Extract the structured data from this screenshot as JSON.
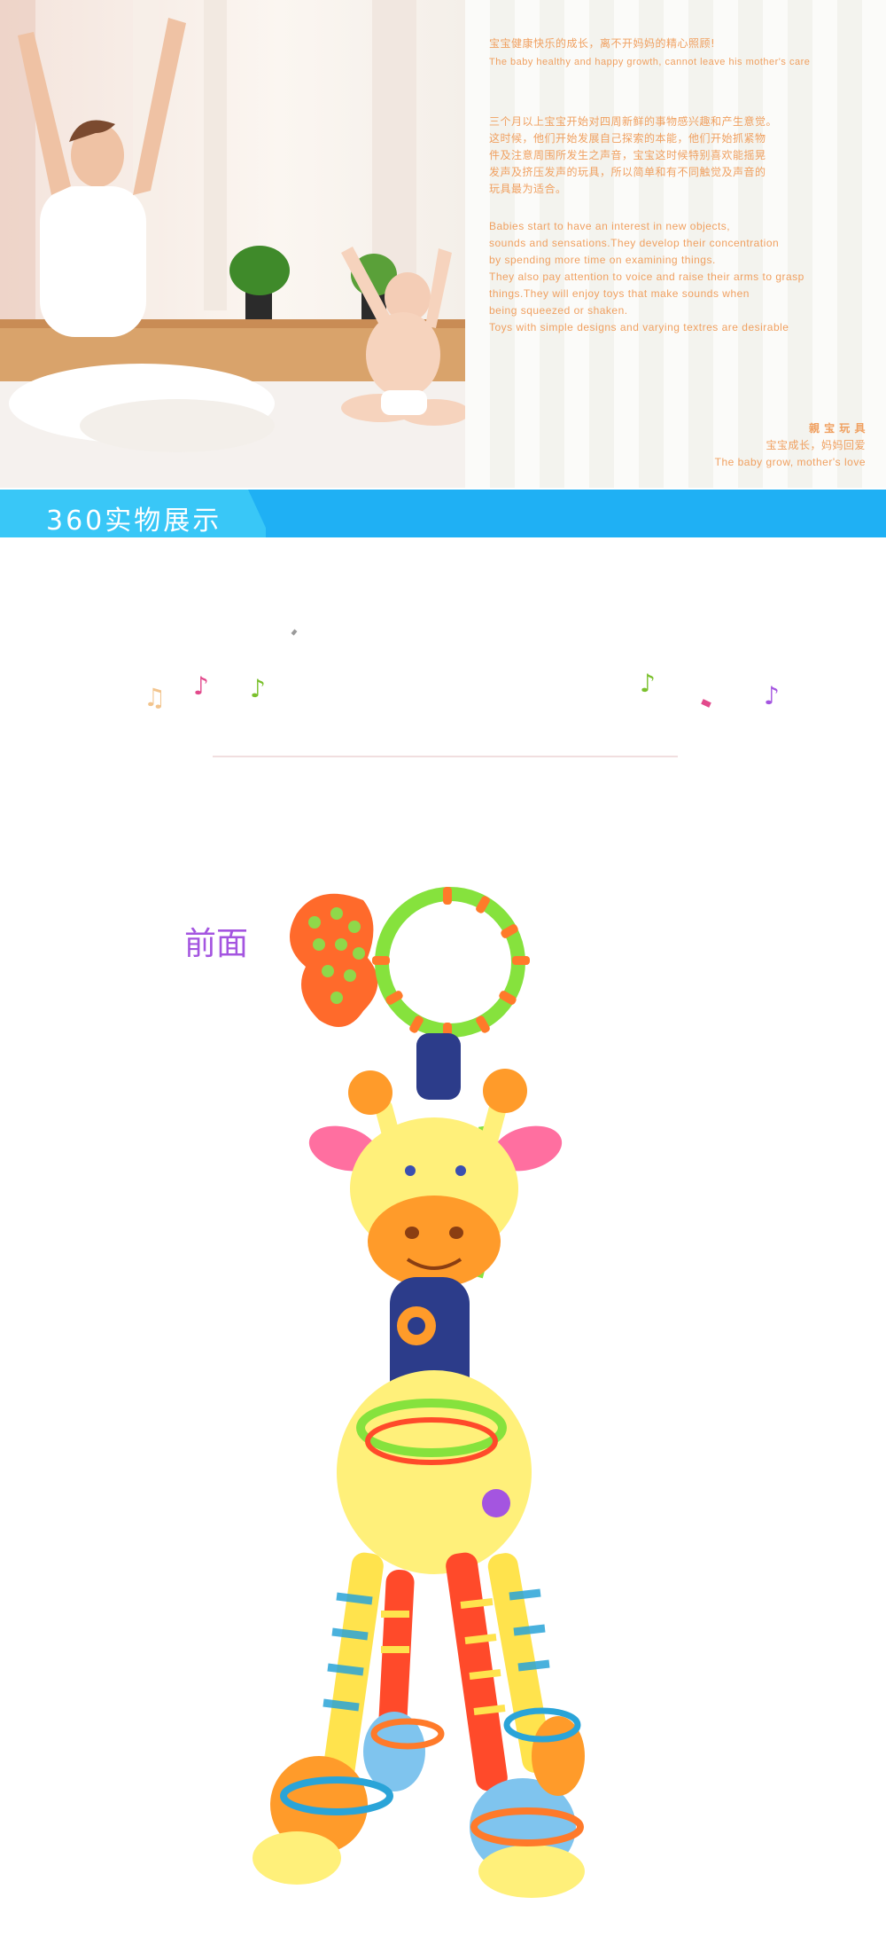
{
  "hero": {
    "slogan_cn": "宝宝健康快乐的成长，离不开妈妈的精心照顾!",
    "slogan_en": "The baby healthy and happy growth, cannot leave his mother's care",
    "para_cn": [
      "三个月以上宝宝开始对四周新鲜的事物感兴趣和产生意觉。",
      "这时候，他们开始发展自己探索的本能，他们开始抓紧物",
      "件及注意周围所发生之声音，宝宝这时候特别喜欢能摇晃",
      "发声及挤压发声的玩具，所以简单和有不同触觉及声音的",
      "玩具最为适合。"
    ],
    "para_en": [
      "Babies start to have an interest in new objects,",
      "sounds and sensations.They develop their concentration",
      "by spending more time on examining things.",
      "They also pay attention to voice and raise their arms to grasp",
      " things.They will enjoy toys that make sounds when",
      "being squeezed or shaken.",
      "Toys with simple designs and varying textres are desirable"
    ],
    "brand_title": "親 宝 玩 具",
    "brand_line1": "宝宝成长，妈妈回爱",
    "brand_line2": "The baby grow, mother's love"
  },
  "banner": {
    "title": "360实物展示"
  },
  "notes": [
    "♫",
    "♪",
    "♪",
    "♪",
    "♪"
  ],
  "front_label": "前面",
  "colors": {
    "banner_blue": "#1fb0f4",
    "tab_blue": "#39c7f7",
    "label_purple": "#a455e0",
    "text_orange": "#f0a060"
  }
}
